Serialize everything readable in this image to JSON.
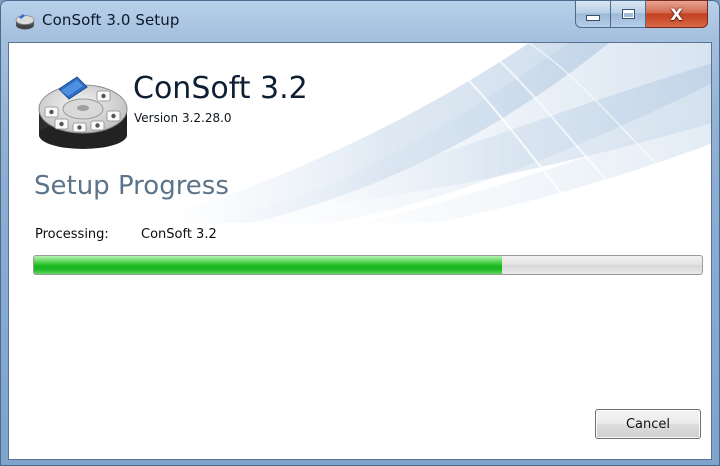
{
  "window": {
    "title": "ConSoft 3.0 Setup",
    "controls": {
      "minimize_icon": "minimize-icon",
      "maximize_icon": "maximize-icon",
      "close_icon": "close-icon",
      "close_glyph": "X"
    }
  },
  "header": {
    "product_name": "ConSoft 3.2",
    "version": "Version 3.2.28.0",
    "logo_icon": "transmitter-head-icon"
  },
  "main": {
    "section_title": "Setup Progress",
    "status_label": "Processing:",
    "status_value": "ConSoft 3.2",
    "progress_fraction": 0.7
  },
  "buttons": {
    "cancel_label": "Cancel"
  },
  "colors": {
    "progress_green": "#18b81f",
    "section_title": "#5c7489",
    "close_red": "#c2401f"
  }
}
